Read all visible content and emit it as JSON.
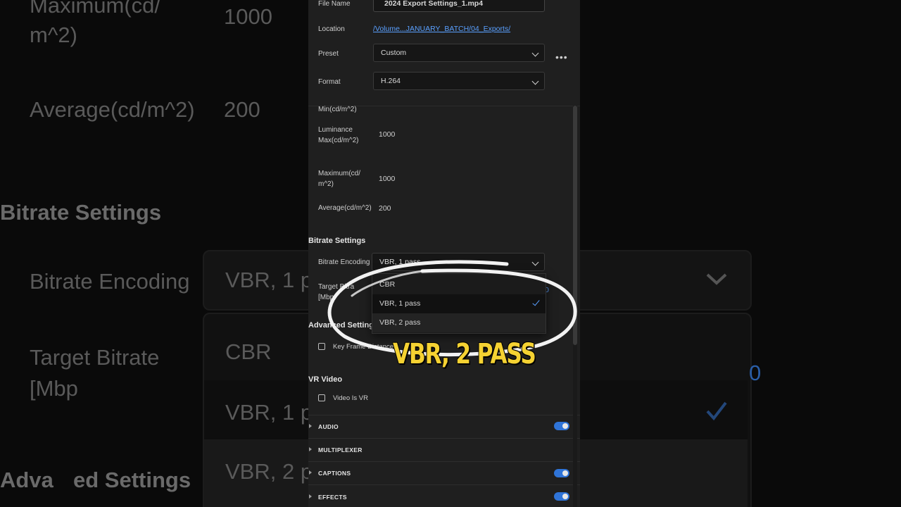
{
  "background": {
    "texts": [
      "Maximum(cd/",
      "m^2)",
      "1000",
      "Average(cd/m^2)",
      "200",
      "Bitrate Settings",
      "Bitrate Encoding",
      "VBR, 1 p",
      "Target Bitrate",
      "[Mbp",
      "CBR",
      "VBR, 1 p",
      "0",
      "Adva",
      "ed Settings",
      "VBR, 2 p"
    ]
  },
  "export": {
    "file_name_label": "File Name",
    "file_name_value": "2024 Export Settings_1.mp4",
    "location_label": "Location",
    "location_value": "/Volume...JANUARY_BATCH/04_Exports/",
    "preset_label": "Preset",
    "preset_value": "Custom",
    "more_label": "•••",
    "format_label": "Format",
    "format_value": "H.264"
  },
  "hdr_settings": {
    "min_label": "Min(cd/m^2)",
    "luminance_max_label_1": "Luminance",
    "luminance_max_label_2": "Max(cd/m^2)",
    "luminance_max_value": "1000",
    "maximum_label_1": "Maximum(cd/",
    "maximum_label_2": "m^2)",
    "maximum_value": "1000",
    "average_label": "Average(cd/m^2)",
    "average_value": "200"
  },
  "bitrate": {
    "section_title": "Bitrate Settings",
    "encoding_label": "Bitrate Encoding",
    "encoding_value": "VBR, 1 pass",
    "target_label_1": "Target Bitra",
    "target_label_2": "[Mbp",
    "target_value_partial": "0",
    "options": [
      "CBR",
      "VBR, 1 pass",
      "VBR, 2 pass"
    ]
  },
  "advanced": {
    "section_title": "Advanced Settings",
    "keyframe_label": "Key Frame Distance"
  },
  "vr": {
    "section_title": "VR Video",
    "video_is_vr_label": "Video Is VR"
  },
  "sections": [
    {
      "label": "AUDIO",
      "toggle": true
    },
    {
      "label": "MULTIPLEXER",
      "toggle": false
    },
    {
      "label": "CAPTIONS",
      "toggle": true
    },
    {
      "label": "EFFECTS",
      "toggle": true
    }
  ],
  "overlay": {
    "caption": "VBR, 2 PASS"
  },
  "colors": {
    "accent": "#2f74d8",
    "link": "#5aa0ff",
    "caption": "#f5d232"
  }
}
